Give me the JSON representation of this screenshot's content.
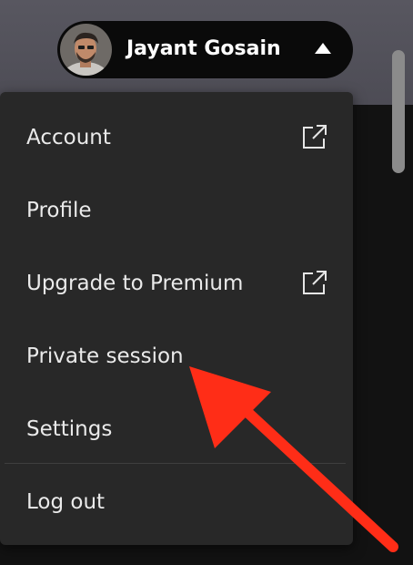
{
  "header": {
    "user_name": "Jayant Gosain",
    "avatar_icon": "user-avatar",
    "caret_icon": "caret-up-icon"
  },
  "menu": {
    "items": [
      {
        "label": "Account",
        "icon": "external-link-icon"
      },
      {
        "label": "Profile"
      },
      {
        "label": "Upgrade to Premium",
        "icon": "external-link-icon"
      },
      {
        "label": "Private session"
      },
      {
        "label": "Settings"
      },
      {
        "label": "Log out"
      }
    ]
  },
  "annotation": {
    "arrow_color": "#ff2d17"
  },
  "colors": {
    "menu_background": "#282828",
    "pill_background": "#0a0a0a",
    "header_background": "#585760",
    "page_background": "#121212"
  }
}
